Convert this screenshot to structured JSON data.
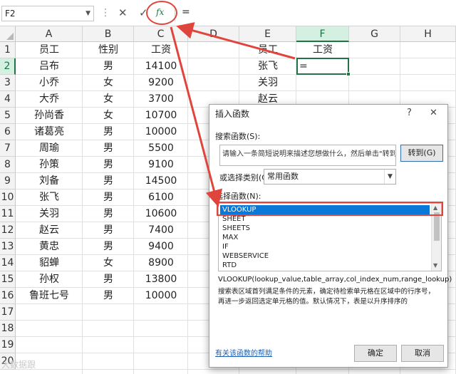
{
  "formula_bar": {
    "name_box": "F2",
    "dots": "⋮",
    "cancel_icon": "✕",
    "enter_icon": "✓",
    "fx_label": "fx",
    "formula": "="
  },
  "columns": [
    "A",
    "B",
    "C",
    "D",
    "E",
    "F",
    "G",
    "H"
  ],
  "rows": [
    "1",
    "2",
    "3",
    "4",
    "5",
    "6",
    "7",
    "8",
    "9",
    "10",
    "11",
    "12",
    "13",
    "14",
    "15",
    "16",
    "17",
    "18",
    "19",
    "20"
  ],
  "table_headers": {
    "name": "员工",
    "gender": "性别",
    "salary": "工资"
  },
  "employees": [
    {
      "name": "吕布",
      "gender": "男",
      "salary": "14100"
    },
    {
      "name": "小乔",
      "gender": "女",
      "salary": "9200"
    },
    {
      "name": "大乔",
      "gender": "女",
      "salary": "3700"
    },
    {
      "name": "孙尚香",
      "gender": "女",
      "salary": "10700"
    },
    {
      "name": "诸葛亮",
      "gender": "男",
      "salary": "10000"
    },
    {
      "name": "周瑜",
      "gender": "男",
      "salary": "5500"
    },
    {
      "name": "孙策",
      "gender": "男",
      "salary": "9100"
    },
    {
      "name": "刘备",
      "gender": "男",
      "salary": "14500"
    },
    {
      "name": "张飞",
      "gender": "男",
      "salary": "6100"
    },
    {
      "name": "关羽",
      "gender": "男",
      "salary": "10600"
    },
    {
      "name": "赵云",
      "gender": "男",
      "salary": "7400"
    },
    {
      "name": "黄忠",
      "gender": "男",
      "salary": "9400"
    },
    {
      "name": "貂蝉",
      "gender": "女",
      "salary": "8900"
    },
    {
      "name": "孙权",
      "gender": "男",
      "salary": "13800"
    },
    {
      "name": "鲁班七号",
      "gender": "男",
      "salary": "10000"
    }
  ],
  "lookup_table": {
    "header_name": "员工",
    "header_salary": "工资",
    "names": [
      "张飞",
      "关羽",
      "赵云"
    ],
    "active_value": "="
  },
  "dialog": {
    "title": "插入函数",
    "help": "?",
    "close": "✕",
    "search_label": "搜索函数(S):",
    "search_text": "请输入一条简短说明来描述您想做什么，然后单击\"转到\"",
    "go_button": "转到(G)",
    "category_label": "或选择类别(C):",
    "category_value": "常用函数",
    "select_label": "选择函数(N):",
    "functions": [
      "VLOOKUP",
      "SHEET",
      "SHEETS",
      "MAX",
      "IF",
      "WEBSERVICE",
      "RTD"
    ],
    "selected_function": "VLOOKUP",
    "signature": "VLOOKUP(lookup_value,table_array,col_index_num,range_lookup)",
    "description": "搜索表区域首列满足条件的元素，确定待检索单元格在区域中的行序号，再进一步返回选定单元格的值。默认情况下，表是以升序排序的",
    "help_link": "有关该函数的帮助",
    "ok": "确定",
    "cancel": "取消"
  },
  "accent_colors": {
    "excel_green": "#217346",
    "annotation_red": "#e0453d",
    "selection_blue": "#0a78d7"
  },
  "watermark": "大数据跟"
}
